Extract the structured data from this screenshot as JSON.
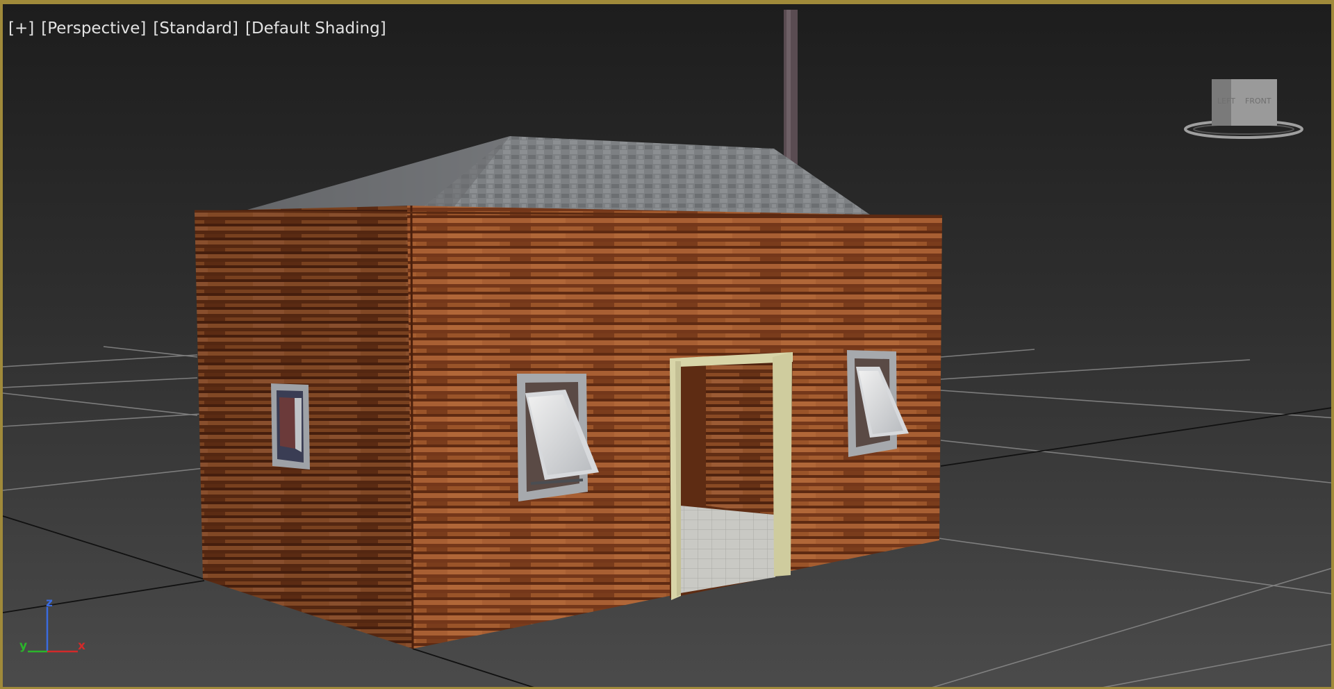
{
  "viewport": {
    "labels": {
      "plus": "[+]",
      "view": "[Perspective]",
      "mode": "[Standard]",
      "shading": "[Default Shading]"
    },
    "viewcube": {
      "left_face": "LEFT",
      "front_face": "FRONT"
    },
    "axis_tripod": {
      "z": "z",
      "y": "y",
      "x": "x"
    }
  },
  "colors": {
    "frame": "#a08a3a",
    "background_top": "#1e1e1e",
    "background_bottom": "#4a4a4a",
    "wood": "#8a4a22",
    "roof": "#7b7d80",
    "door_frame": "#d8d5a8",
    "axis_x": "#d22a2a",
    "axis_y": "#2bb52b",
    "axis_z": "#3a6be0"
  }
}
